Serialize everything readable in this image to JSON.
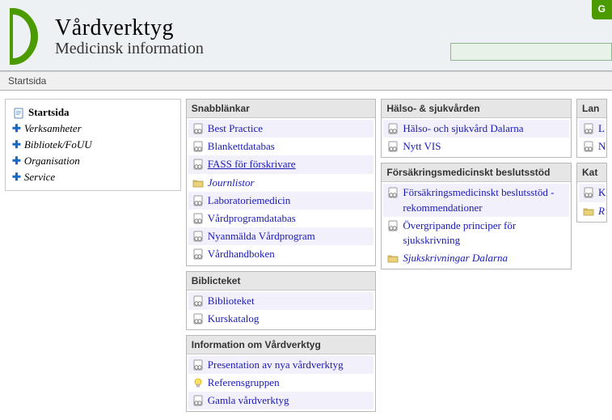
{
  "header": {
    "title": "Vårdverktyg",
    "subtitle": "Medicinsk information",
    "top_button": "G"
  },
  "breadcrumb": "Startsida",
  "nav": {
    "items": [
      {
        "label": "Startsida",
        "icon": "page",
        "current": true
      },
      {
        "label": "Verksamheter",
        "icon": "plus"
      },
      {
        "label": "Bibliotek/FoUU",
        "icon": "plus"
      },
      {
        "label": "Organisation",
        "icon": "plus"
      },
      {
        "label": "Service",
        "icon": "plus"
      }
    ]
  },
  "col_a": [
    {
      "title": "Snabblänkar",
      "links": [
        {
          "label": "Best Practice",
          "icon": "link"
        },
        {
          "label": "Blankettdatabas",
          "icon": "link"
        },
        {
          "label": "FASS för förskrivare",
          "icon": "link",
          "underline": true
        },
        {
          "label": "Journlistor",
          "icon": "folder",
          "italic": true
        },
        {
          "label": "Laboratoriemedicin",
          "icon": "link"
        },
        {
          "label": "Vårdprogramdatabas",
          "icon": "link"
        },
        {
          "label": "Nyanmälda Vårdprogram",
          "icon": "link"
        },
        {
          "label": "Vårdhandboken",
          "icon": "link"
        }
      ]
    },
    {
      "title": "Biblicteket",
      "links": [
        {
          "label": "Biblioteket",
          "icon": "link"
        },
        {
          "label": "Kurskatalog",
          "icon": "link"
        }
      ]
    },
    {
      "title": "Information om Vårdverktyg",
      "links": [
        {
          "label": "Presentation av nya vårdverktyg",
          "icon": "link"
        },
        {
          "label": "Referensgruppen",
          "icon": "bulb"
        },
        {
          "label": "Gamla vårdverktyg",
          "icon": "link"
        }
      ]
    }
  ],
  "col_b": [
    {
      "title": "Hälso- & sjukvården",
      "links": [
        {
          "label": "Hälso- och sjukvård Dalarna",
          "icon": "link"
        },
        {
          "label": "Nytt VIS",
          "icon": "link"
        }
      ]
    },
    {
      "title": "Försäkringsmedicinskt beslutsstöd",
      "links": [
        {
          "label": "Försäkringsmedicinskt beslutsstöd - rekommendationer",
          "icon": "link"
        },
        {
          "label": "Övergripande principer för sjukskrivning",
          "icon": "link"
        },
        {
          "label": "Sjukskrivningar Dalarna",
          "icon": "folder",
          "italic": true
        }
      ]
    }
  ],
  "col_c": [
    {
      "title": "Lan",
      "links": [
        {
          "label": "L",
          "icon": "link"
        },
        {
          "label": "N",
          "icon": "link"
        }
      ]
    },
    {
      "title": "Kat",
      "links": [
        {
          "label": "K",
          "icon": "link"
        },
        {
          "label": "R",
          "icon": "folder",
          "italic": true
        }
      ]
    }
  ]
}
